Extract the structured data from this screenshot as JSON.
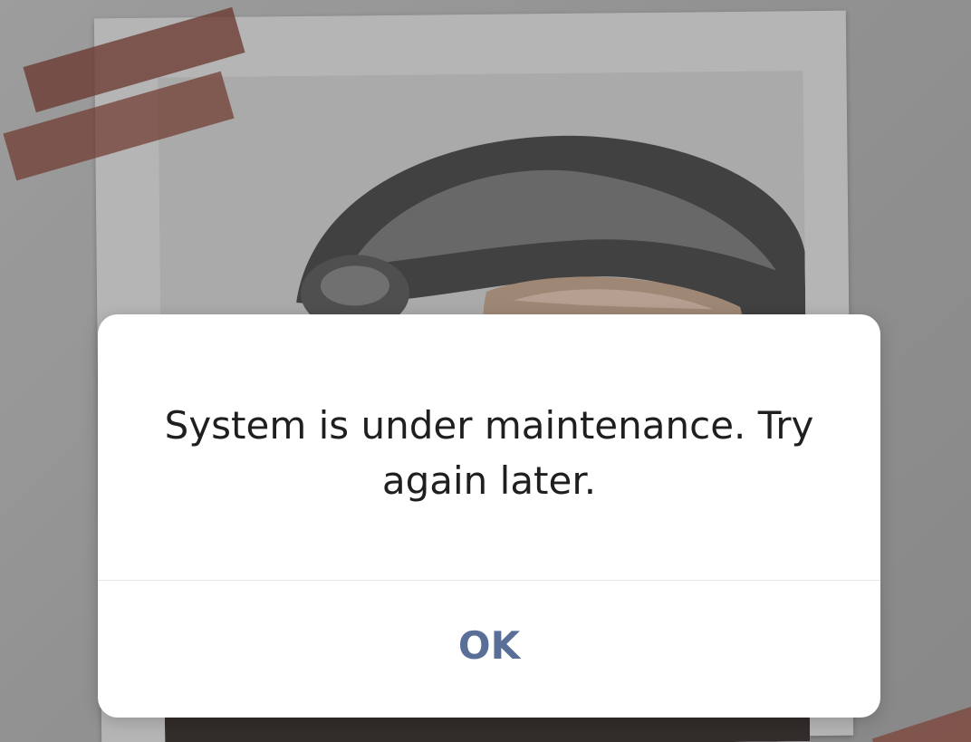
{
  "background": {
    "description_icon": "polaroid-photo-with-tape",
    "tape_color": "#7a3e32"
  },
  "dialog": {
    "message": "System is under maintenance. Try again later.",
    "ok_label": "OK",
    "accent_color": "#5a6f97"
  }
}
